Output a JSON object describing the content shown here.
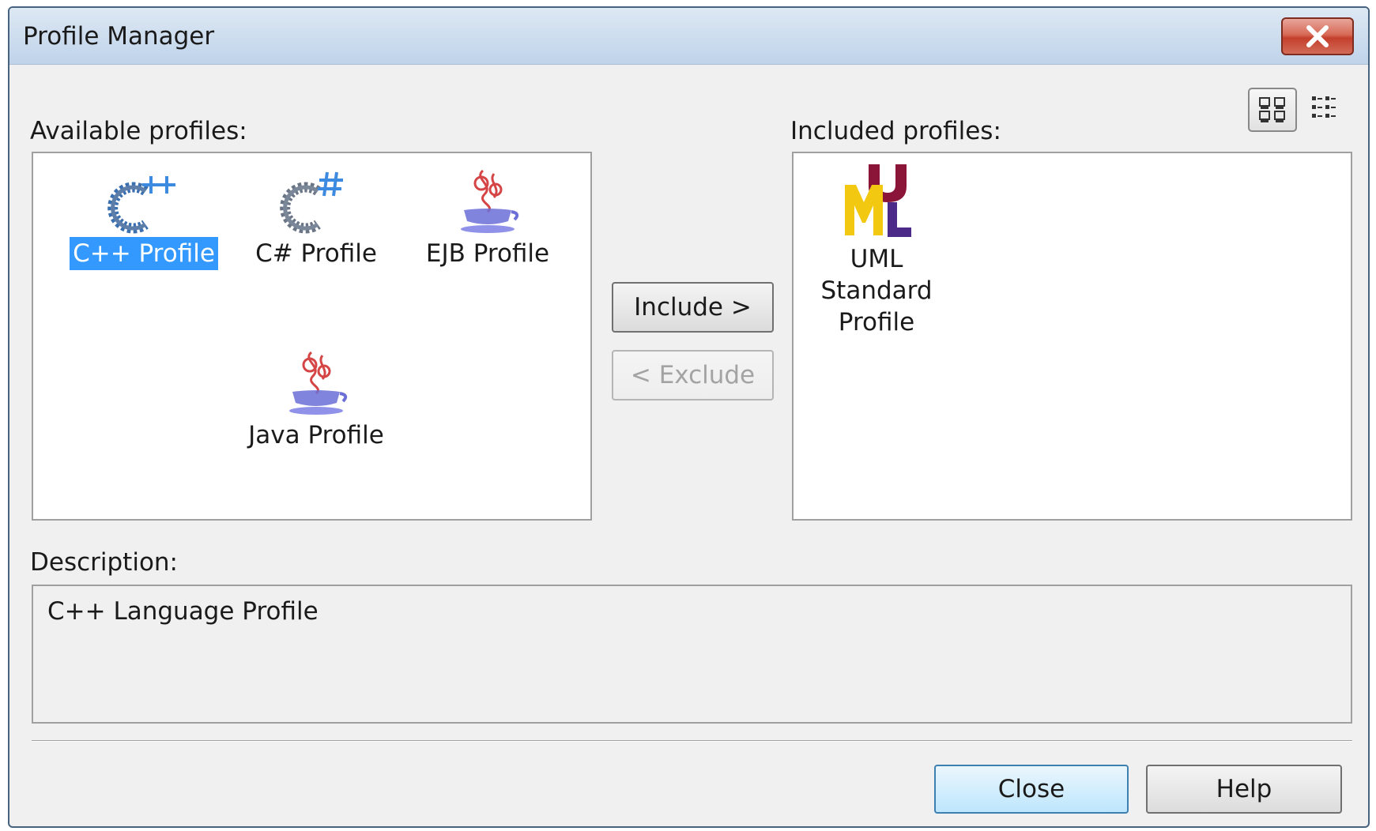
{
  "window": {
    "title": "Profile Manager",
    "close_icon": "close-icon"
  },
  "view_toggle": {
    "large_icons": "large-icons-view-icon",
    "details": "details-view-icon"
  },
  "available": {
    "label": "Available profiles:",
    "items": [
      {
        "label": "C++ Profile",
        "icon": "cpp-icon",
        "selected": true
      },
      {
        "label": "C# Profile",
        "icon": "csharp-icon",
        "selected": false
      },
      {
        "label": "EJB Profile",
        "icon": "java-cup-icon",
        "selected": false
      },
      {
        "label": "Java Profile",
        "icon": "java-cup-icon",
        "selected": false
      }
    ]
  },
  "actions": {
    "include_label": "Include >",
    "exclude_label": "< Exclude"
  },
  "included": {
    "label": "Included profiles:",
    "items": [
      {
        "label_line1": "UML Standard",
        "label_line2": "Profile",
        "icon": "uml-icon"
      }
    ]
  },
  "description": {
    "label": "Description:",
    "text": "C++ Language Profile"
  },
  "footer": {
    "close_label": "Close",
    "help_label": "Help"
  },
  "colors": {
    "selection": "#3399ff",
    "title_gradient_top": "#dde8f3",
    "close_button": "#c33f2c"
  }
}
